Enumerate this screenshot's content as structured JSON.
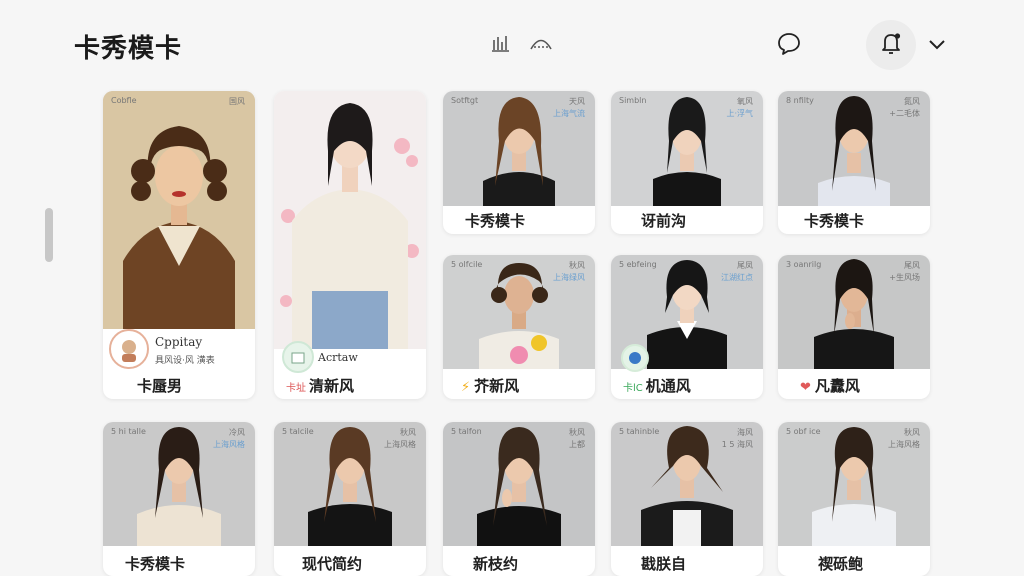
{
  "header": {
    "title": "卡秀模卡",
    "icons": [
      "bar-chart-icon",
      "hanger-icon",
      "chat-bubble-icon",
      "bell-icon",
      "chevron-down-icon"
    ]
  },
  "colors": {
    "background": "#f6f6f6",
    "card": "#ffffff",
    "accent_blue": "#6a9fcf"
  },
  "cards": [
    {
      "label": "卡蜃男",
      "tag": "Cobfle",
      "tag_r": "国风",
      "brand_name": "Cppitay",
      "brand_sub": "具风设·风 潢表"
    },
    {
      "label": "清新风",
      "prefix": "卡址",
      "tag": "",
      "brand_name": "Acrtaw"
    },
    {
      "label": "卡秀模卡",
      "tag": "Sotftgt",
      "tag_r": "天风",
      "tag_r2": "上海气流"
    },
    {
      "label": "讶前沟",
      "tag": "Simbln",
      "tag_r": "氧风",
      "tag_r2": "上·浮气"
    },
    {
      "label": "卡秀模卡",
      "tag": "8 nfilty",
      "tag_r": "氮风",
      "tag_r2": "+二毛体"
    },
    {
      "label": "芥新风",
      "tag": "5 olfcile",
      "tag_r": "秋风",
      "tag_r2": "上海绿风"
    },
    {
      "label": "机通风",
      "prefix": "卡lC",
      "tag": "5 ebfeing",
      "tag_r": "尾凤",
      "tag_r2": "江湖红点"
    },
    {
      "label": "凡纛风",
      "tag": "3 oanrilg",
      "tag_r": "尾风",
      "tag_r2": "+生风场"
    },
    {
      "label": "卡秀模卡",
      "tag": "5 hi talle",
      "tag_r": "冷风",
      "tag_r2": "上海风格"
    },
    {
      "label": "现代简约",
      "tag": "5 talcile",
      "tag_r": "秋风",
      "tag_r2": "上海风格"
    },
    {
      "label": "新枝约",
      "tag": "5 talfon",
      "tag_r": "秋风",
      "tag_r2": "上都"
    },
    {
      "label": "戡朕自",
      "tag": "5 tahinble",
      "tag_r": "海风",
      "tag_r2": "1 5 海风"
    },
    {
      "label": "禊砾鲍",
      "tag": "5 obf ice",
      "tag_r": "秋风",
      "tag_r2": "上海风格"
    }
  ]
}
